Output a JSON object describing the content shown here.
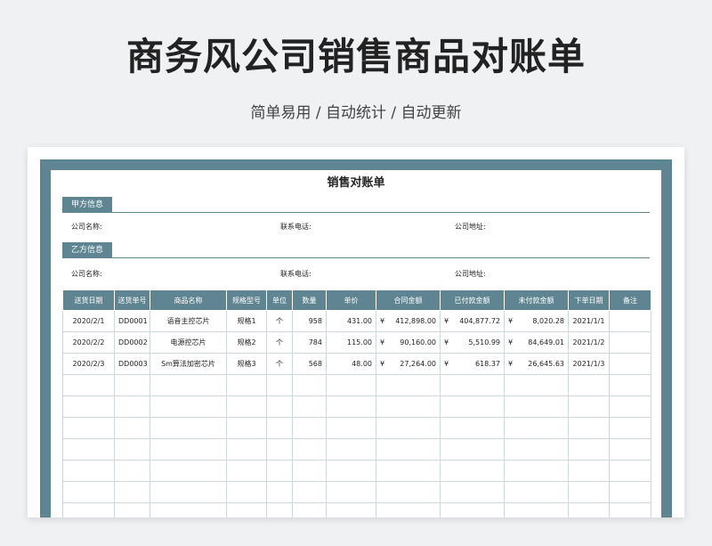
{
  "header": {
    "title": "商务风公司销售商品对账单",
    "subtitle": "简单易用  /  自动统计  /  自动更新"
  },
  "document": {
    "title": "销售对账单",
    "party_a": {
      "label": "甲方信息",
      "company_label": "公司名称:",
      "phone_label": "联系电话:",
      "address_label": "公司地址:"
    },
    "party_b": {
      "label": "乙方信息",
      "company_label": "公司名称:",
      "phone_label": "联系电话:",
      "address_label": "公司地址:"
    },
    "currency_symbol": "¥",
    "table": {
      "headers": [
        "送货日期",
        "送货单号",
        "商品名称",
        "规格型号",
        "单位",
        "数量",
        "单价",
        "合同金额",
        "已付款金额",
        "未付款金额",
        "下单日期",
        "备注"
      ],
      "rows": [
        [
          "2020/2/1",
          "DD0001",
          "语音主控芯片",
          "规格1",
          "个",
          "958",
          "431.00",
          "412,898.00",
          "404,877.72",
          "8,020.28",
          "2021/1/1",
          ""
        ],
        [
          "2020/2/2",
          "DD0002",
          "电源控芯片",
          "规格2",
          "个",
          "784",
          "115.00",
          "90,160.00",
          "5,510.99",
          "84,649.01",
          "2021/1/2",
          ""
        ],
        [
          "2020/2/3",
          "DD0003",
          "Sm算法加密芯片",
          "规格3",
          "个",
          "568",
          "48.00",
          "27,264.00",
          "618.37",
          "26,645.63",
          "2021/1/3",
          ""
        ]
      ],
      "empty_rows": 7
    }
  },
  "colors": {
    "accent": "#5f8592",
    "background": "#f0f1f3"
  }
}
